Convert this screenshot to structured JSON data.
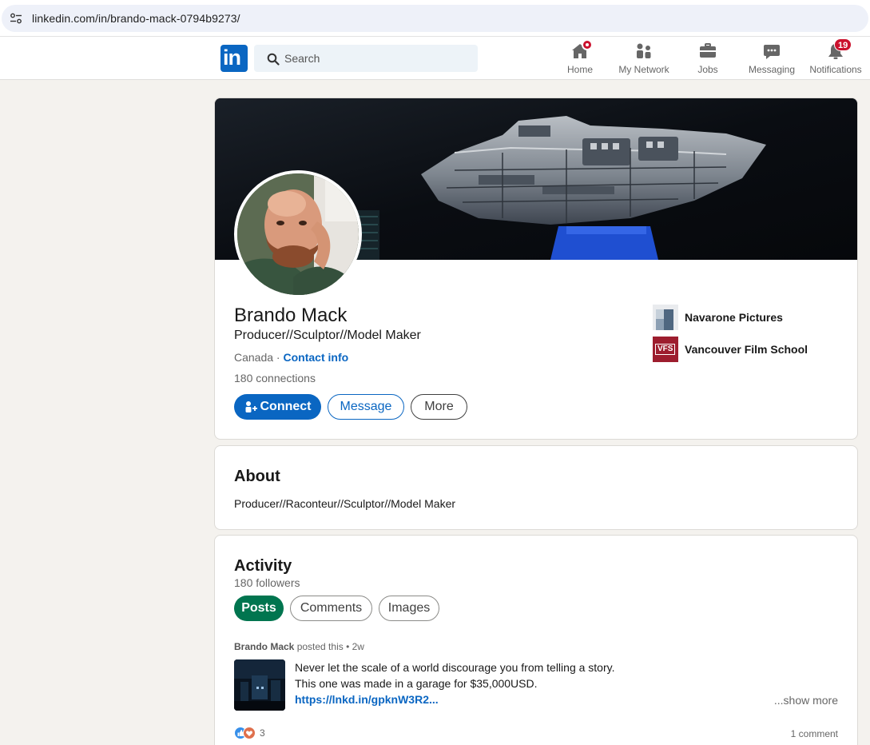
{
  "browser": {
    "url": "linkedin.com/in/brando-mack-0794b9273/"
  },
  "nav": {
    "logo_text": "in",
    "search_placeholder": "Search",
    "items": [
      {
        "label": "Home",
        "icon": "home-icon"
      },
      {
        "label": "My Network",
        "icon": "people-icon"
      },
      {
        "label": "Jobs",
        "icon": "briefcase-icon"
      },
      {
        "label": "Messaging",
        "icon": "chat-icon"
      },
      {
        "label": "Notifications",
        "icon": "bell-icon",
        "badge": "19"
      }
    ]
  },
  "profile": {
    "name": "Brando Mack",
    "headline": "Producer//Sculptor//Model Maker",
    "location": "Canada",
    "separator": " · ",
    "contact_info": "Contact info",
    "connections": "180 connections",
    "buttons": {
      "connect": "Connect",
      "message": "Message",
      "more": "More"
    },
    "organizations": [
      {
        "name": "Navarone Pictures"
      },
      {
        "name": "Vancouver Film School",
        "logo_text": "VFS"
      }
    ]
  },
  "about": {
    "title": "About",
    "text": "Producer//Raconteur//Sculptor//Model Maker"
  },
  "activity": {
    "title": "Activity",
    "followers": "180 followers",
    "tabs": [
      "Posts",
      "Comments",
      "Images"
    ],
    "post": {
      "author": "Brando Mack",
      "meta": " posted this • 2w",
      "line1": "Never let the scale of a world discourage you from telling a story.",
      "line2": "This one was made in a garage for $35,000USD.",
      "link": "https://lnkd.in/gpknW3R2...",
      "show_more": "...show more",
      "reaction_count": "3",
      "comments": "1 comment"
    }
  },
  "colors": {
    "brand": "#0a66c2",
    "posts_active": "#01754f",
    "badge": "#cb112d",
    "page_bg": "#f4f2ee"
  }
}
